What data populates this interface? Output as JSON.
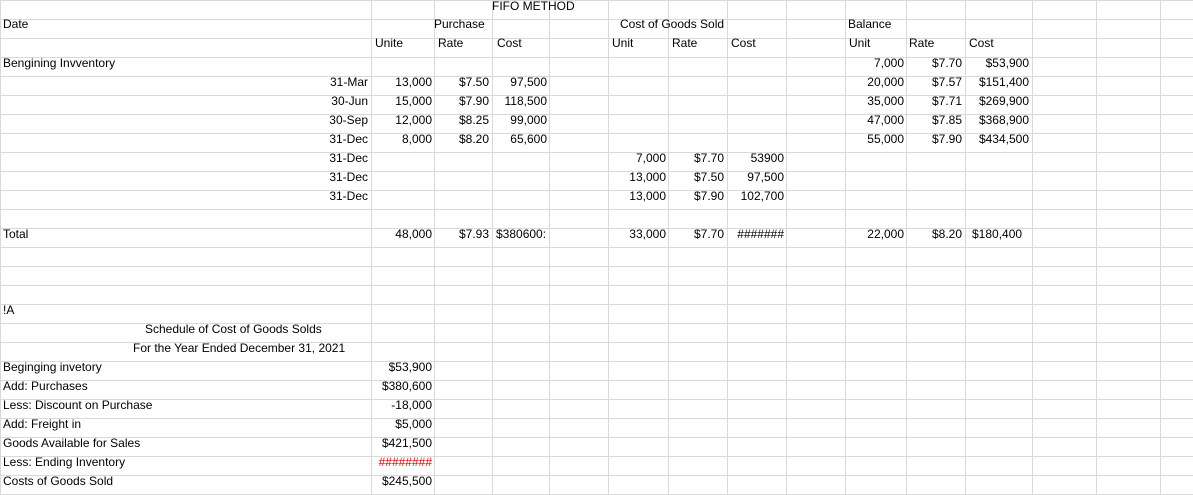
{
  "title": "FIFO METHOD",
  "headers": {
    "date": "Date",
    "purchase": "Purchase",
    "cogs": "Cost of Goods Sold",
    "balance": "Balance",
    "unite": "Unite",
    "rate": "Rate",
    "cost": "Cost",
    "unit": "Unit"
  },
  "beginning": {
    "label": "Bengining Invventory",
    "bal_unit": "7,000",
    "bal_rate": "$7.70",
    "bal_cost": "$53,900"
  },
  "purchase_rows": [
    {
      "date": "31-Mar",
      "units": "13,000",
      "rate": "$7.50",
      "cost": "97,500",
      "bal_unit": "20,000",
      "bal_rate": "$7.57",
      "bal_cost": "$151,400"
    },
    {
      "date": "30-Jun",
      "units": "15,000",
      "rate": "$7.90",
      "cost": "118,500",
      "bal_unit": "35,000",
      "bal_rate": "$7.71",
      "bal_cost": "$269,900"
    },
    {
      "date": "30-Sep",
      "units": "12,000",
      "rate": "$8.25",
      "cost": "99,000",
      "bal_unit": "47,000",
      "bal_rate": "$7.85",
      "bal_cost": "$368,900"
    },
    {
      "date": "31-Dec",
      "units": "8,000",
      "rate": "$8.20",
      "cost": "65,600",
      "bal_unit": "55,000",
      "bal_rate": "$7.90",
      "bal_cost": "$434,500"
    }
  ],
  "cogs_rows": [
    {
      "date": "31-Dec",
      "unit": "7,000",
      "rate": "$7.70",
      "cost": "53900"
    },
    {
      "date": "31-Dec",
      "unit": "13,000",
      "rate": "$7.50",
      "cost": "97,500"
    },
    {
      "date": "31-Dec",
      "unit": "13,000",
      "rate": "$7.90",
      "cost": "102,700"
    }
  ],
  "total": {
    "label": "Total",
    "p_units": "48,000",
    "p_rate": "$7.93",
    "p_cost": "$380600:",
    "c_unit": "33,000",
    "c_rate": "$7.70",
    "c_cost": "#######",
    "b_unit": "22,000",
    "b_rate": "$8.20",
    "b_cost": "$180,400"
  },
  "marker": "!A",
  "schedule": {
    "title": "Schedule of Cost  of Goods Solds",
    "subtitle": "For the Year Ended December 31, 2021",
    "rows": [
      {
        "label": "Beginging invetory",
        "value": "$53,900"
      },
      {
        "label": "Add: Purchases",
        "value": "$380,600"
      },
      {
        "label": "Less: Discount on Purchase",
        "value": "-18,000"
      },
      {
        "label": "Add: Freight in",
        "value": "$5,000"
      },
      {
        "label": "Goods Available for Sales",
        "value": "$421,500"
      },
      {
        "label": "Less: Ending Inventory",
        "value": "########"
      },
      {
        "label": "Costs of Goods Sold",
        "value": "$245,500"
      }
    ],
    "error_color": "#e00000"
  }
}
